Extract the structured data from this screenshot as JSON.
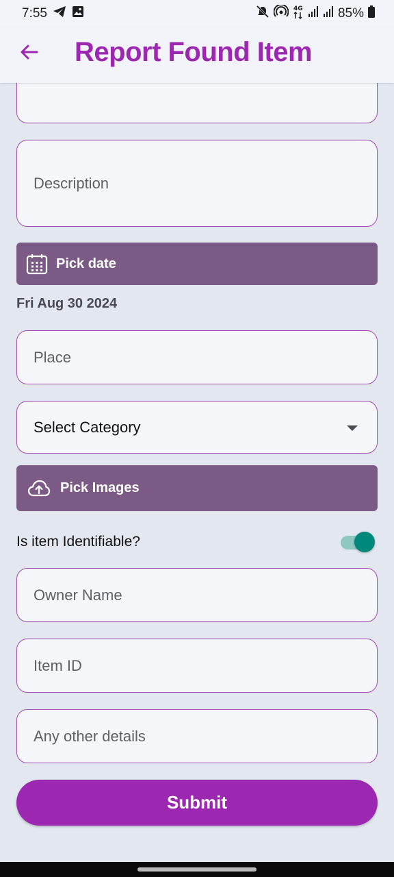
{
  "status_bar": {
    "time": "7:55",
    "battery": "85%",
    "icons": [
      "telegram-icon",
      "gallery-icon",
      "mute-icon",
      "hotspot-icon",
      "4g-icon",
      "signal-icon",
      "signal-icon",
      "battery-icon"
    ]
  },
  "header": {
    "title": "Report Found Item",
    "back_icon": "arrow-left-icon"
  },
  "form": {
    "description_placeholder": "Description",
    "pick_date_label": "Pick date",
    "selected_date": "Fri Aug 30 2024",
    "place_placeholder": "Place",
    "category_value": "Select Category",
    "pick_images_label": "Pick Images",
    "identifiable_label": "Is item Identifiable?",
    "identifiable_on": true,
    "owner_name_placeholder": "Owner Name",
    "item_id_placeholder": "Item ID",
    "other_details_placeholder": "Any other details",
    "submit_label": "Submit"
  },
  "colors": {
    "accent": "#9c27b0",
    "button_purple": "#7b5a85",
    "toggle_on": "#00897b"
  }
}
